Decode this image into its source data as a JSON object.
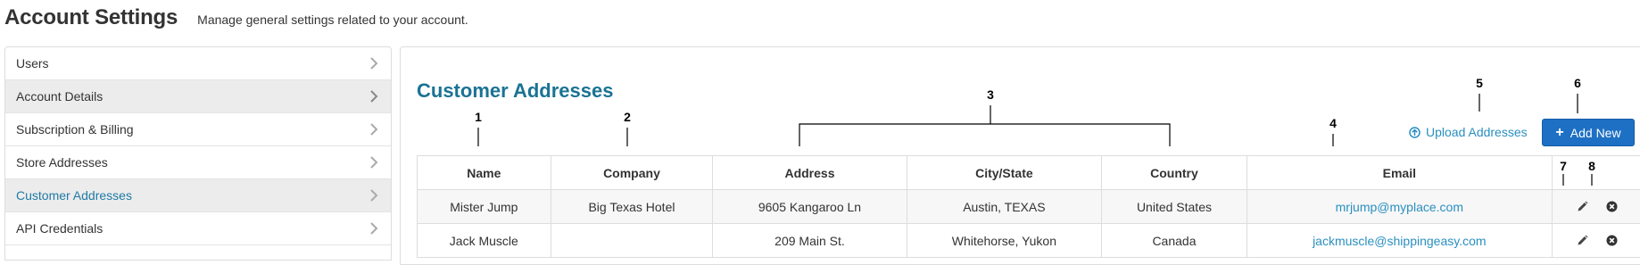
{
  "header": {
    "title": "Account Settings",
    "subtitle": "Manage general settings related to your account."
  },
  "sidebar": {
    "items": [
      {
        "label": "Users"
      },
      {
        "label": "Account Details"
      },
      {
        "label": "Subscription & Billing"
      },
      {
        "label": "Store Addresses"
      },
      {
        "label": "Customer Addresses"
      },
      {
        "label": "API Credentials"
      }
    ]
  },
  "main": {
    "title": "Customer Addresses",
    "upload_label": "Upload Addresses",
    "add_label": "Add New",
    "table": {
      "columns": [
        "Name",
        "Company",
        "Address",
        "City/State",
        "Country",
        "Email"
      ],
      "rows": [
        {
          "name": "Mister Jump",
          "company": "Big Texas Hotel",
          "address": "9605 Kangaroo Ln",
          "city": "Austin, TEXAS",
          "country": "United States",
          "email": "mrjump@myplace.com"
        },
        {
          "name": "Jack Muscle",
          "company": "",
          "address": "209 Main St.",
          "city": "Whitehorse, Yukon",
          "country": "Canada",
          "email": "jackmuscle@shippingeasy.com"
        }
      ]
    }
  },
  "annotations": [
    "1",
    "2",
    "3",
    "4",
    "5",
    "6",
    "7",
    "8"
  ],
  "colors": {
    "accent": "#1a7394",
    "link": "#2a8fc0",
    "button": "#1d70c4"
  }
}
